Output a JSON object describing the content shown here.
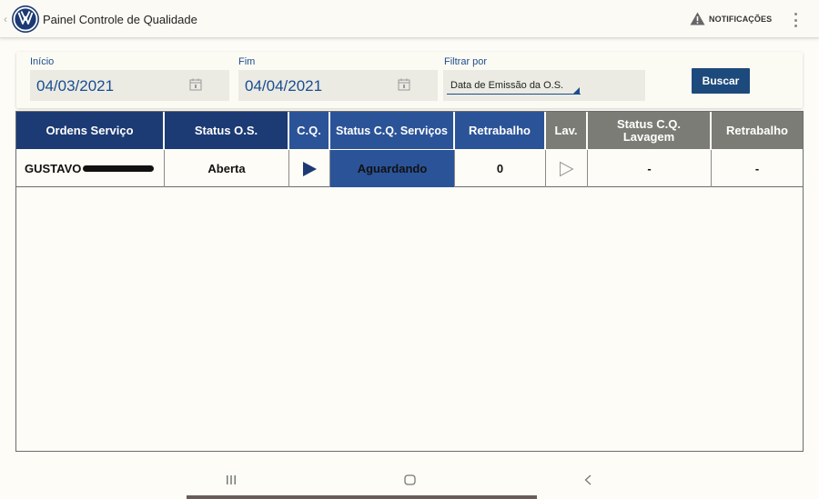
{
  "app": {
    "title": "Painel Controle de Qualidade",
    "notifications_label": "NOTIFICAÇÕES"
  },
  "filters": {
    "start_label": "Início",
    "start_value": "04/03/2021",
    "end_label": "Fim",
    "end_value": "04/04/2021",
    "filter_label": "Filtrar por",
    "filter_value": "Data de Emissão da O.S.",
    "search_button": "Buscar"
  },
  "table": {
    "headers": [
      "Ordens Serviço",
      "Status O.S.",
      "C.Q.",
      "Status C.Q. Serviços",
      "Retrabalho",
      "Lav.",
      "Status C.Q. Lavagem",
      "Retrabalho"
    ],
    "rows": [
      {
        "ordem": "GUSTAVO",
        "status_os": "Aberta",
        "status_cq_servicos": "Aguardando",
        "retrabalho": "0",
        "status_cq_lavagem": "-",
        "retrabalho_lavagem": "-"
      }
    ]
  },
  "colors": {
    "navy": "#1c3a73",
    "blue": "#2b5398",
    "gray": "#7c7c76",
    "accent_text": "#1b4d8f"
  },
  "icons": [
    "vw-logo-icon",
    "warning-icon",
    "more-vert-icon",
    "calendar-icon",
    "play-filled-icon",
    "play-outline-icon",
    "recents-icon",
    "home-icon",
    "back-icon"
  ]
}
